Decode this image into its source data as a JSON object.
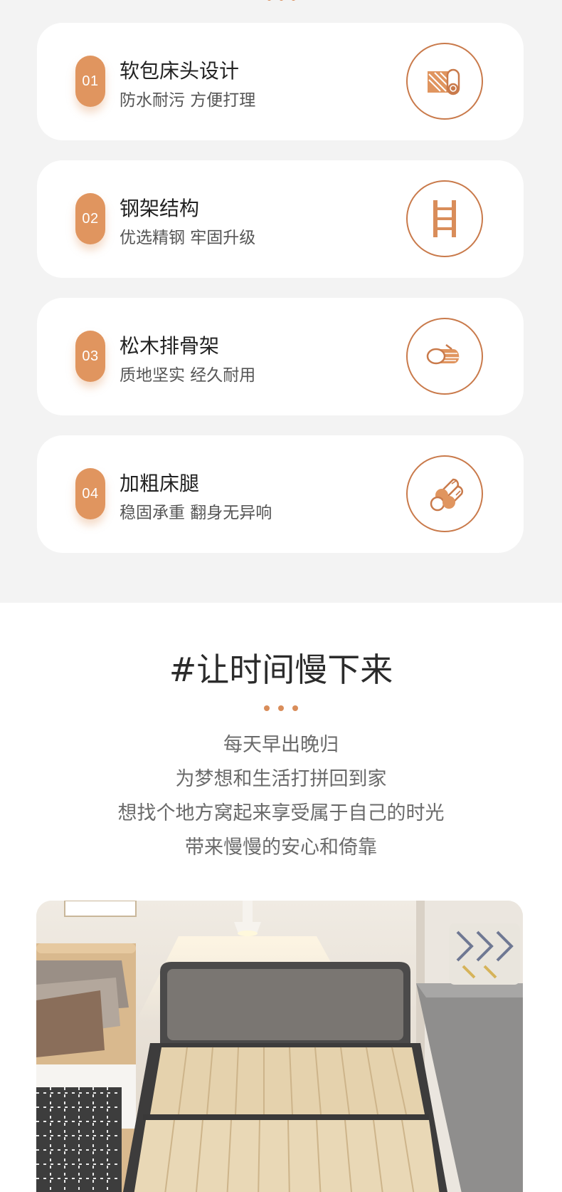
{
  "features": [
    {
      "num": "01",
      "title": "软包床头设计",
      "subtitle": "防水耐污 方便打理",
      "icon": "fabric-roll-icon"
    },
    {
      "num": "02",
      "title": "钢架结构",
      "subtitle": "优选精钢 牢固升级",
      "icon": "steel-ladder-icon"
    },
    {
      "num": "03",
      "title": "松木排骨架",
      "subtitle": "质地坚实 经久耐用",
      "icon": "pine-log-icon"
    },
    {
      "num": "04",
      "title": "加粗床腿",
      "subtitle": "稳固承重 翻身无异响",
      "icon": "thick-legs-icon"
    }
  ],
  "section": {
    "title": "#让时间慢下来",
    "lines": [
      "每天早出晚归",
      "为梦想和生活打拼回到家",
      "想找个地方窝起来享受属于自己的时光",
      "带来慢慢的安心和倚靠"
    ]
  },
  "colors": {
    "accent": "#e0955f",
    "icon_stroke": "#c97a4b",
    "background": "#f3f3f3"
  }
}
